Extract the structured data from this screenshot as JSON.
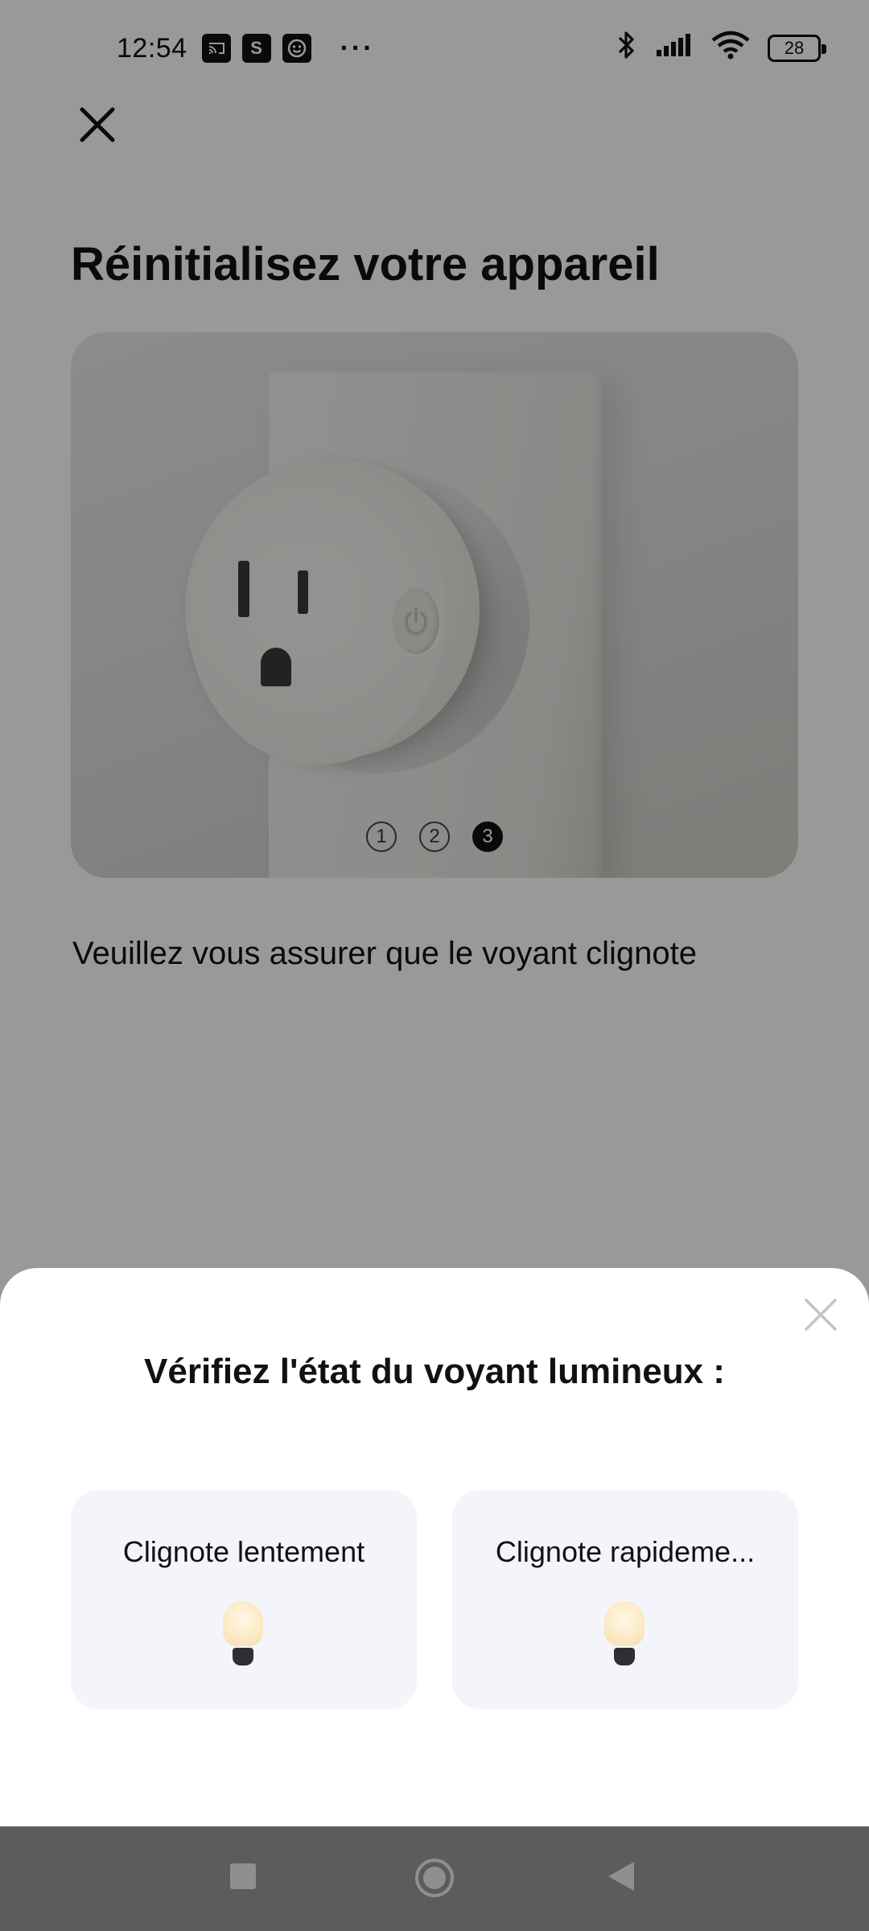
{
  "status_bar": {
    "time": "12:54",
    "notif_icons": [
      "cast-icon",
      "s-app-icon",
      "smile-icon"
    ],
    "notif_s": "S",
    "more": "···",
    "battery": "28"
  },
  "screen": {
    "title": "Réinitialisez votre appareil",
    "steps": [
      "1",
      "2",
      "3"
    ],
    "active_step": 3,
    "instruction": "Veuillez vous assurer que le voyant clignote"
  },
  "sheet": {
    "title": "Vérifiez l'état du voyant lumineux :",
    "options": [
      {
        "label": "Clignote lentement",
        "icon": "lightbulb-icon"
      },
      {
        "label": "Clignote rapideme...",
        "icon": "lightbulb-icon"
      }
    ]
  },
  "nav": {
    "buttons": [
      "recents-icon",
      "home-icon",
      "back-icon"
    ]
  },
  "colors": {
    "scrim": "rgba(0,0,0,0.40)",
    "option_bg": "#f4f5fa",
    "text": "#111111"
  }
}
